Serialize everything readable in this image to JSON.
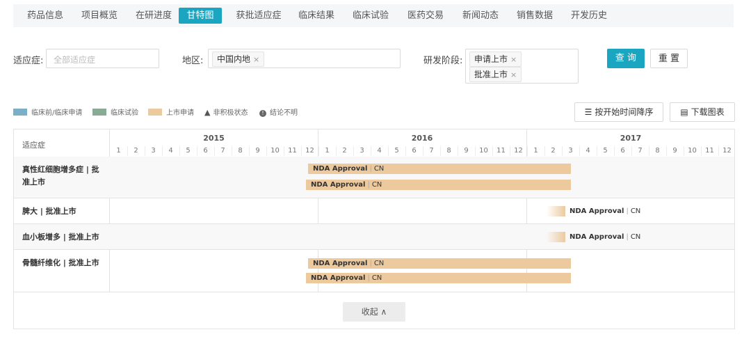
{
  "tabs": [
    "药品信息",
    "项目概览",
    "在研进度",
    "甘特图",
    "获批适应症",
    "临床结果",
    "临床试验",
    "医药交易",
    "新闻动态",
    "销售数据",
    "开发历史"
  ],
  "active_tab": "甘特图",
  "filters": {
    "indication_label": "适应症:",
    "indication_placeholder": "全部适应症",
    "region_label": "地区:",
    "region_chips": [
      "中国内地"
    ],
    "stage_label": "研发阶段:",
    "stage_chips": [
      "申请上市",
      "批准上市"
    ],
    "query_button": "查 询",
    "reset_button": "重 置"
  },
  "legend": [
    {
      "label": "临床前/临床申请",
      "color": "#7aafc7"
    },
    {
      "label": "临床试验",
      "color": "#88ab95"
    },
    {
      "label": "上市申请",
      "color": "#edc99e"
    },
    {
      "label": "非积极状态",
      "icon": "triangle-icon"
    },
    {
      "label": "结论不明",
      "icon": "info-icon"
    }
  ],
  "sort_button": "按开始时间降序",
  "download_button": "下载图表",
  "gantt": {
    "label_header": "适应症",
    "years": [
      "2015",
      "2016",
      "2017"
    ],
    "months": [
      "1",
      "2",
      "3",
      "4",
      "5",
      "6",
      "7",
      "8",
      "9",
      "10",
      "11",
      "12"
    ],
    "rows": [
      {
        "label": "真性红细胞增多症 | 批准上市",
        "bars": [
          {
            "start": "2015-12",
            "end": "2017-03",
            "text": "NDA Approval",
            "region": "CN"
          },
          {
            "start": "2015-12",
            "end": "2017-03",
            "text": "NDA Approval",
            "region": "CN"
          }
        ]
      },
      {
        "label": "脾大 | 批准上市",
        "bars": [
          {
            "start": "2017-02",
            "end": "2017-03",
            "text": "NDA Approval",
            "region": "CN",
            "fade": true
          }
        ]
      },
      {
        "label": "血小板增多 | 批准上市",
        "bars": [
          {
            "start": "2017-02",
            "end": "2017-03",
            "text": "NDA Approval",
            "region": "CN",
            "fade": true
          }
        ]
      },
      {
        "label": "骨髓纤维化 | 批准上市",
        "bars": [
          {
            "start": "2015-12",
            "end": "2017-03",
            "text": "NDA Approval",
            "region": "CN"
          },
          {
            "start": "2015-12",
            "end": "2017-03",
            "text": "NDA Approval",
            "region": "CN"
          }
        ]
      }
    ]
  },
  "collapse_button": "收起 ∧"
}
